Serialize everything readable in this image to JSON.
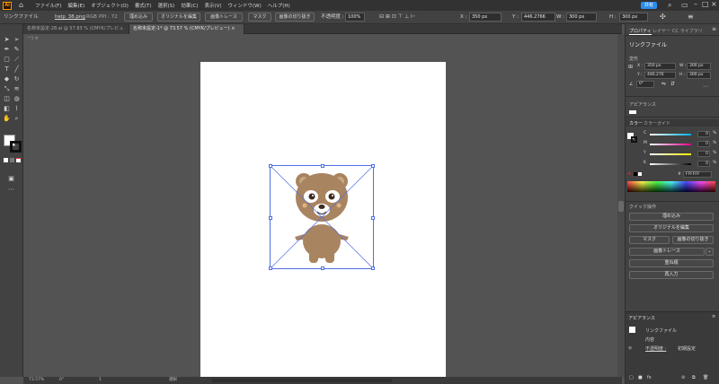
{
  "menubar": {
    "app_logo": "Ai",
    "menus": [
      "ファイル(F)",
      "編集(E)",
      "オブジェクト(O)",
      "書式(T)",
      "選択(S)",
      "効果(C)",
      "表示(V)",
      "ウィンドウ(W)",
      "ヘルプ(H)"
    ],
    "share_label": "共有"
  },
  "control": {
    "object_type": "リンクファイル",
    "filename": "heip_38.png",
    "color_info": "RGB",
    "ppi_info": "PPI : 72",
    "embed_label": "埋め込み",
    "edit_original_label": "オリジナルを編集",
    "image_trace_label": "画像トレース",
    "mask_label": "マスク",
    "crop_label": "画像の切り抜き",
    "opacity_label": "不透明度 :",
    "opacity_value": "100%",
    "x_label": "X :",
    "x_value": "350 px",
    "y_label": "Y :",
    "y_value": "446.2766",
    "w_label": "W :",
    "w_value": "300 px",
    "h_label": "H :",
    "h_value": "300 px"
  },
  "tabs": [
    {
      "label": "名称未設定-28.ai @ 57.83 % (CMYK/プレビュー)"
    },
    {
      "label": "名称未設定-1* @ 73.57 % (CMYK/プレビュー)"
    }
  ],
  "status": {
    "zoom": "73.57%",
    "rotation": "0°",
    "page": "1",
    "tool": "選択"
  },
  "panel": {
    "tabs": [
      "プロパティ",
      "レイヤー",
      "CC ライブラリ"
    ],
    "object_type": "リンクファイル",
    "transform_label": "変形",
    "x_label": "X :",
    "x_value": "350 px",
    "y_label": "Y :",
    "y_value": "446.276",
    "w_label": "W :",
    "w_value": "300 px",
    "h_label": "H :",
    "h_value": "300 px",
    "angle_value": "0°",
    "appearance_label": "アピアランス",
    "color_tabs": [
      "カラー",
      "カラーガイド"
    ],
    "cmyk": [
      {
        "label": "C",
        "value": "0",
        "unit": "%"
      },
      {
        "label": "M",
        "value": "0",
        "unit": "%"
      },
      {
        "label": "Y",
        "value": "0",
        "unit": "%"
      },
      {
        "label": "K",
        "value": "0",
        "unit": "%"
      }
    ],
    "hex_value": "FFFFFF",
    "quick_actions_label": "クイック操作",
    "buttons": {
      "embed": "埋め込み",
      "edit_original": "オリジナルを編集",
      "mask": "マスク",
      "crop": "画像の切り抜き",
      "image_trace": "画像トレース",
      "arrange": "重ね順",
      "reenter": "再入力"
    },
    "appearance_panel_label": "アピアランス",
    "appearance_rows": [
      "リンクファイル",
      "内容",
      "不透明度 :",
      "初期設定"
    ]
  },
  "colors": {
    "bear_body": "#a98460",
    "bear_face": "#ffffff",
    "selection": "#4f6ee8",
    "accent": "#2d8ceb"
  }
}
